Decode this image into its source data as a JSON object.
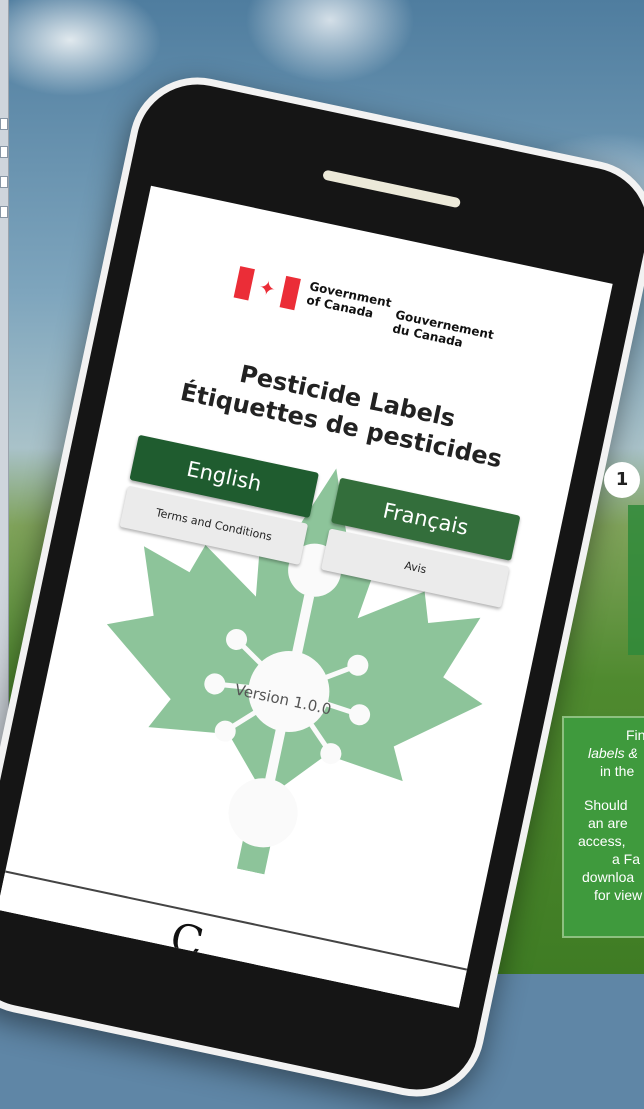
{
  "gov_logo": {
    "en_text": "Government\nof Canada",
    "fr_text": "Gouvernement\ndu Canada"
  },
  "app": {
    "title_en": "Pesticide Labels",
    "title_fr": "Étiquettes de pesticides",
    "english_button": "English",
    "francais_button": "Français",
    "terms_button": "Terms and Conditions",
    "avis_button": "Avis",
    "version": "Version 1.0.0"
  },
  "bottom_bar_glyph": "C",
  "step_number": "1",
  "info_box": {
    "para1": [
      "Find",
      "labels &",
      "in the"
    ],
    "para2": [
      "Should",
      "an are",
      "access,",
      "a Fa",
      "downloa",
      "for view"
    ]
  },
  "colors": {
    "brand_green_dark": "#1f5c2f",
    "brand_green": "#336e3b",
    "leaf_green": "#8dc49a",
    "canada_red": "#eb2d37"
  },
  "icons": {
    "flag": "canada-flag-icon",
    "leaf": "maple-leaf-icon",
    "molecule": "molecule-icon"
  }
}
